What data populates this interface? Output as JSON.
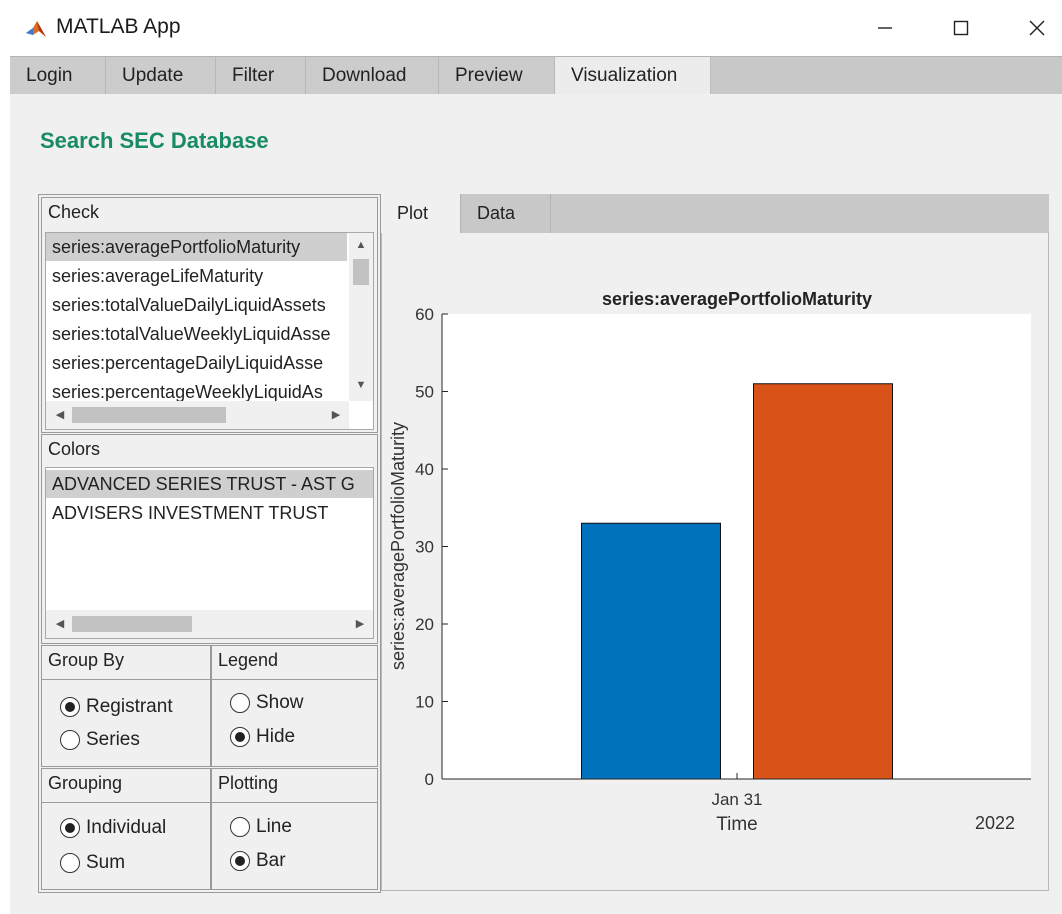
{
  "window": {
    "title": "MATLAB App",
    "minimize_icon": "minimize-icon",
    "maximize_icon": "maximize-icon",
    "close_icon": "close-icon",
    "app_icon": "matlab-icon"
  },
  "top_tabs": [
    {
      "label": "Login"
    },
    {
      "label": "Update"
    },
    {
      "label": "Filter"
    },
    {
      "label": "Download"
    },
    {
      "label": "Preview"
    },
    {
      "label": "Visualization",
      "active": true
    }
  ],
  "heading": "Search SEC Database",
  "check": {
    "title": "Check",
    "items": [
      "series:averagePortfolioMaturity",
      "series:averageLifeMaturity",
      "series:totalValueDailyLiquidAssets",
      "series:totalValueWeeklyLiquidAsse",
      "series:percentageDailyLiquidAsse",
      "series:percentageWeeklyLiquidAs"
    ],
    "selected": "series:averagePortfolioMaturity"
  },
  "colors": {
    "title": "Colors",
    "items": [
      "ADVANCED SERIES TRUST - AST G",
      "ADVISERS INVESTMENT TRUST"
    ],
    "selected": "ADVANCED SERIES TRUST - AST G"
  },
  "group_by": {
    "title": "Group By",
    "options": [
      "Registrant",
      "Series"
    ],
    "selected": "Registrant"
  },
  "legend": {
    "title": "Legend",
    "options": [
      "Show",
      "Hide"
    ],
    "selected": "Hide"
  },
  "grouping": {
    "title": "Grouping",
    "options": [
      "Individual",
      "Sum"
    ],
    "selected": "Individual"
  },
  "plotting": {
    "title": "Plotting",
    "options": [
      "Line",
      "Bar"
    ],
    "selected": "Bar"
  },
  "plot_tabs": [
    {
      "label": "Plot",
      "active": true
    },
    {
      "label": "Data"
    }
  ],
  "chart_data": {
    "type": "bar",
    "title": "series:averagePortfolioMaturity",
    "xlabel": "Time",
    "ylabel": "series:averagePortfolioMaturity",
    "x_tick_label": "Jan 31",
    "x_secondary_label": "2022",
    "categories": [
      "Jan 31"
    ],
    "series": [
      {
        "values": [
          33
        ],
        "color": "#0072bd"
      },
      {
        "values": [
          51
        ],
        "color": "#d95319"
      }
    ],
    "ylim": [
      0,
      60
    ],
    "yticks": [
      0,
      10,
      20,
      30,
      40,
      50,
      60
    ],
    "grid": false,
    "legend": "hidden"
  }
}
